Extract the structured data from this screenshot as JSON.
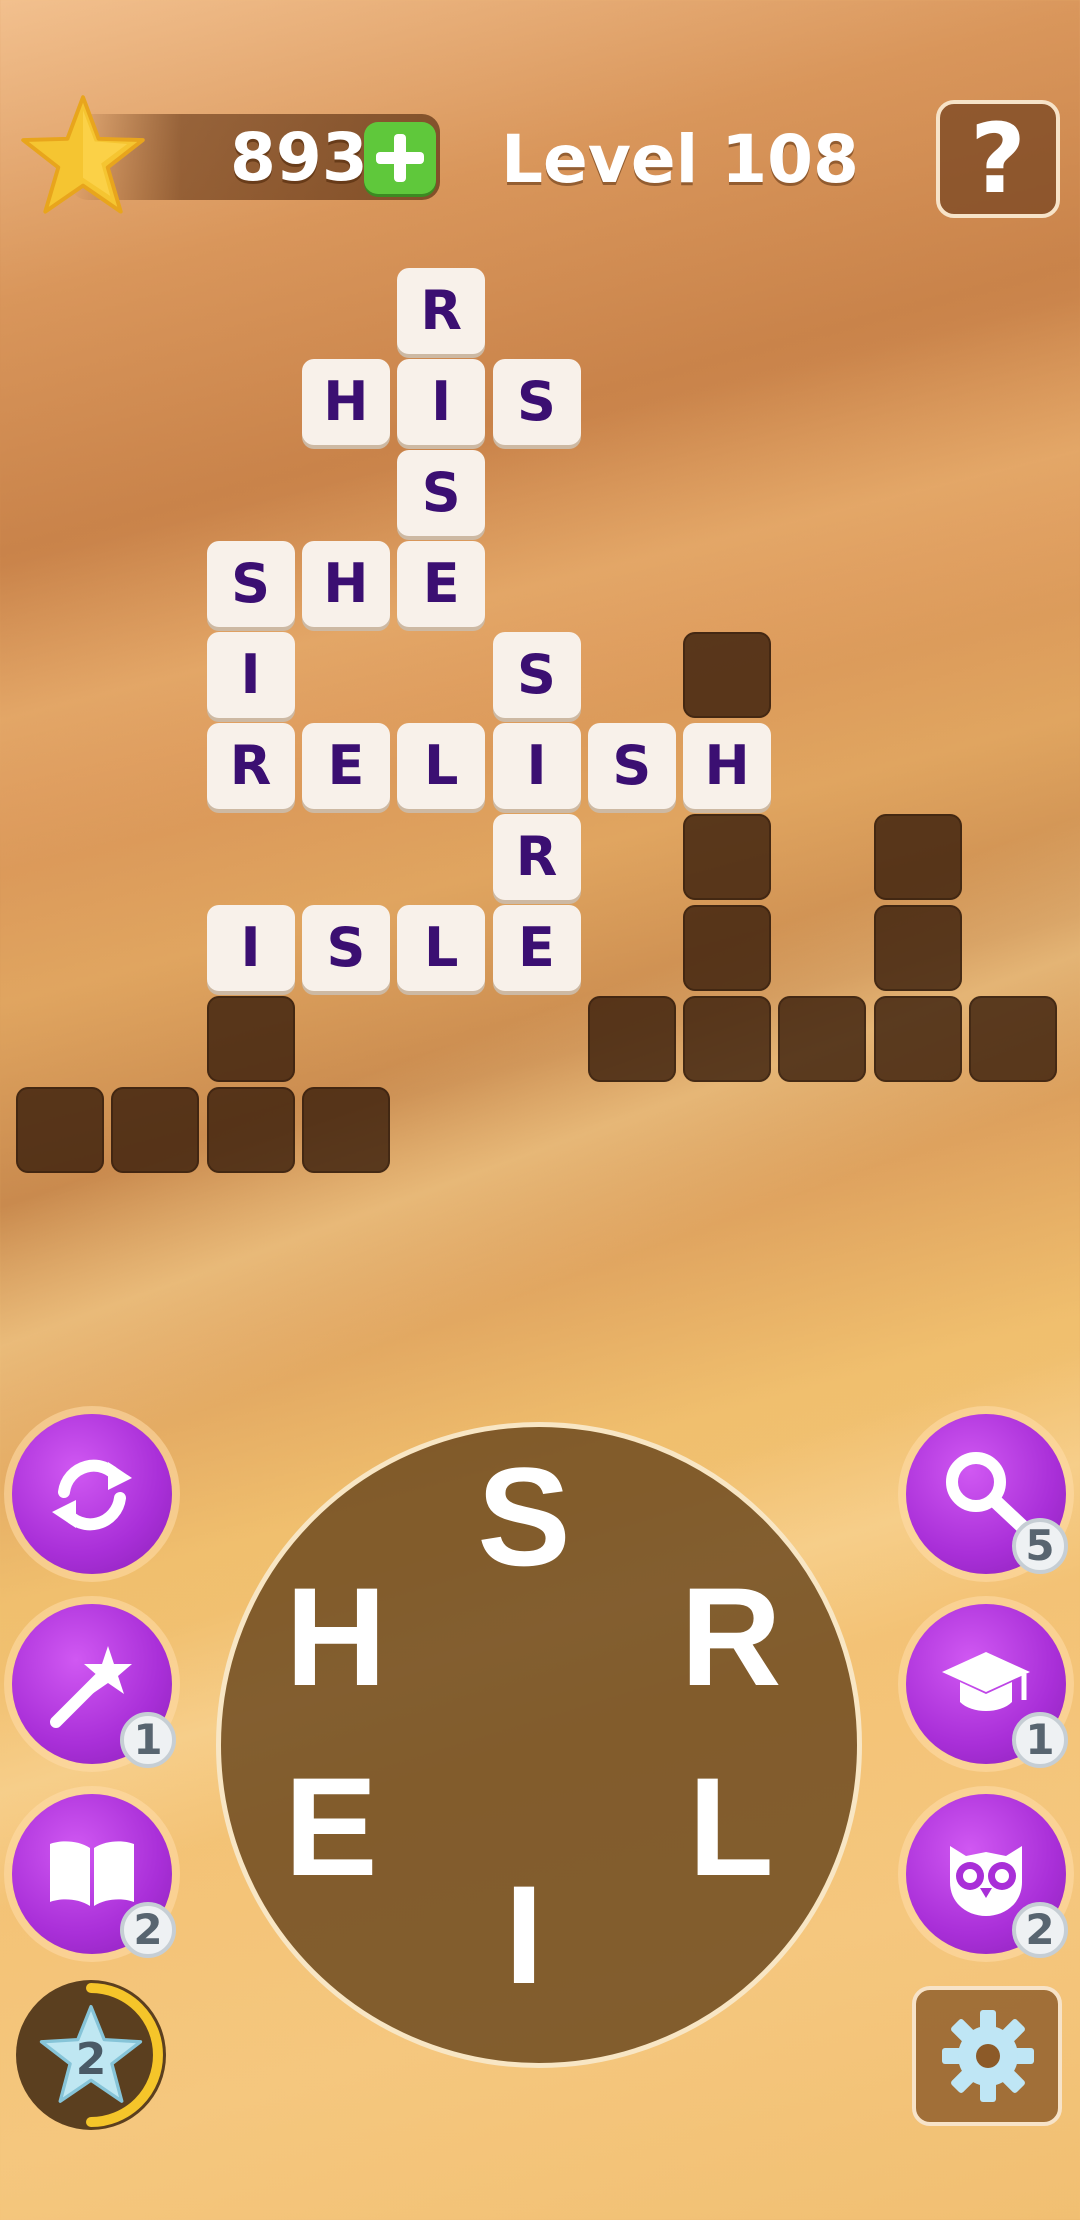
{
  "header": {
    "coins": "893",
    "level_title": "Level 108",
    "help_label": "?"
  },
  "grid": {
    "filled": [
      {
        "row": 0,
        "col": 4,
        "letter": "R"
      },
      {
        "row": 1,
        "col": 3,
        "letter": "H"
      },
      {
        "row": 1,
        "col": 4,
        "letter": "I"
      },
      {
        "row": 1,
        "col": 5,
        "letter": "S"
      },
      {
        "row": 2,
        "col": 4,
        "letter": "S"
      },
      {
        "row": 3,
        "col": 2,
        "letter": "S"
      },
      {
        "row": 3,
        "col": 3,
        "letter": "H"
      },
      {
        "row": 3,
        "col": 4,
        "letter": "E"
      },
      {
        "row": 4,
        "col": 2,
        "letter": "I"
      },
      {
        "row": 4,
        "col": 5,
        "letter": "S"
      },
      {
        "row": 5,
        "col": 2,
        "letter": "R"
      },
      {
        "row": 5,
        "col": 3,
        "letter": "E"
      },
      {
        "row": 5,
        "col": 4,
        "letter": "L"
      },
      {
        "row": 5,
        "col": 5,
        "letter": "I"
      },
      {
        "row": 5,
        "col": 6,
        "letter": "S"
      },
      {
        "row": 5,
        "col": 7,
        "letter": "H"
      },
      {
        "row": 6,
        "col": 5,
        "letter": "R"
      },
      {
        "row": 7,
        "col": 2,
        "letter": "I"
      },
      {
        "row": 7,
        "col": 3,
        "letter": "S"
      },
      {
        "row": 7,
        "col": 4,
        "letter": "L"
      },
      {
        "row": 7,
        "col": 5,
        "letter": "E"
      }
    ],
    "empty": [
      {
        "row": 4,
        "col": 7
      },
      {
        "row": 6,
        "col": 7
      },
      {
        "row": 6,
        "col": 9
      },
      {
        "row": 7,
        "col": 7
      },
      {
        "row": 7,
        "col": 9
      },
      {
        "row": 8,
        "col": 2
      },
      {
        "row": 8,
        "col": 6
      },
      {
        "row": 8,
        "col": 7
      },
      {
        "row": 8,
        "col": 8
      },
      {
        "row": 8,
        "col": 9
      },
      {
        "row": 8,
        "col": 10
      },
      {
        "row": 9,
        "col": 0
      },
      {
        "row": 9,
        "col": 1
      },
      {
        "row": 9,
        "col": 2
      },
      {
        "row": 9,
        "col": 3
      }
    ]
  },
  "wheel": {
    "letters": [
      "S",
      "R",
      "L",
      "I",
      "E",
      "H"
    ]
  },
  "left_buttons": {
    "shuffle": {
      "icon": "shuffle-icon"
    },
    "magic_wand": {
      "icon": "magic-wand-icon",
      "count": "1"
    },
    "book": {
      "icon": "book-icon",
      "count": "2"
    },
    "bonus_star": {
      "icon": "star-icon",
      "count": "2"
    }
  },
  "right_buttons": {
    "search": {
      "icon": "magnifier-icon",
      "count": "5"
    },
    "graduation": {
      "icon": "graduation-cap-icon",
      "count": "1"
    },
    "owl": {
      "icon": "owl-icon",
      "count": "2"
    },
    "settings": {
      "icon": "gear-icon"
    }
  },
  "colors": {
    "tile_letter": "#3b0f72",
    "tile_bg": "#f8f1ea",
    "button_purple": "#a92fd8",
    "plus_green": "#5fc83b"
  }
}
